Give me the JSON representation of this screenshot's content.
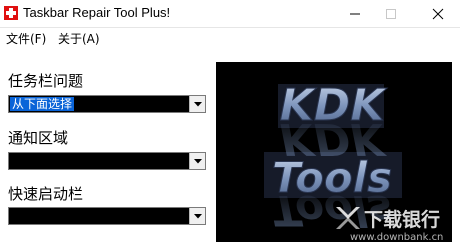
{
  "window": {
    "title": "Taskbar Repair Tool Plus!"
  },
  "menu": {
    "file": "文件(F)",
    "about": "关于(A)"
  },
  "sections": [
    {
      "label": "任务栏问题",
      "selected": "从下面选择"
    },
    {
      "label": "通知区域",
      "selected": ""
    },
    {
      "label": "快速启动栏",
      "selected": ""
    }
  ],
  "logo": {
    "line1": "KDK",
    "line2": "Tools"
  },
  "watermark": {
    "text": "下载银行",
    "url": "www.downbank.cn"
  },
  "colors": {
    "accent": "#0a64d8",
    "logo_fill": "#8fa6c9",
    "combo_bg": "#000000"
  },
  "icons": {
    "app": "red-cross-icon",
    "minimize": "minimize-icon",
    "maximize": "maximize-icon",
    "close": "close-icon",
    "dropdown": "chevron-down-icon"
  }
}
